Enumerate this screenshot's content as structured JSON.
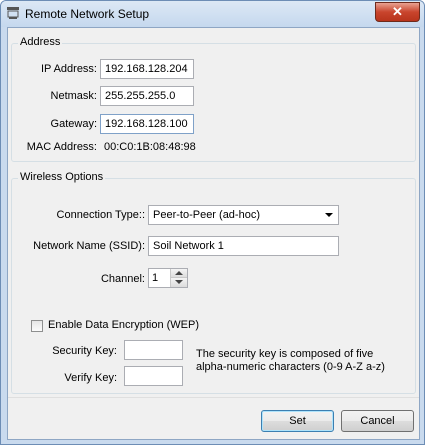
{
  "window": {
    "title": "Remote Network Setup",
    "close_glyph": "✕"
  },
  "address": {
    "group_title": "Address",
    "ip_label": "IP Address:",
    "ip_value": "192.168.128.204",
    "netmask_label": "Netmask:",
    "netmask_value": "255.255.255.0",
    "gateway_label": "Gateway:",
    "gateway_value": "192.168.128.100",
    "mac_label": "MAC Address:",
    "mac_value": "00:C0:1B:08:48:98"
  },
  "wireless": {
    "group_title": "Wireless Options",
    "connection_type_label": "Connection Type::",
    "connection_type_value": "Peer-to-Peer (ad-hoc)",
    "ssid_label": "Network Name (SSID):",
    "ssid_value": "Soil Network 1",
    "channel_label": "Channel:",
    "channel_value": "1",
    "encryption_label": "Enable Data Encryption (WEP)",
    "encryption_checked": false,
    "security_key_label": "Security Key:",
    "security_key_value": "",
    "verify_key_label": "Verify Key:",
    "verify_key_value": "",
    "key_note_line1": "The security key is composed of five",
    "key_note_line2": "alpha-numeric characters (0-9  A-Z  a-z)"
  },
  "buttons": {
    "set_label": "Set",
    "cancel_label": "Cancel"
  },
  "colors": {
    "title_gradient_top": "#dce8f5",
    "close_red": "#c9452d",
    "dialog_bg": "#f0f0f0",
    "default_button_border": "#3c7fb1"
  }
}
